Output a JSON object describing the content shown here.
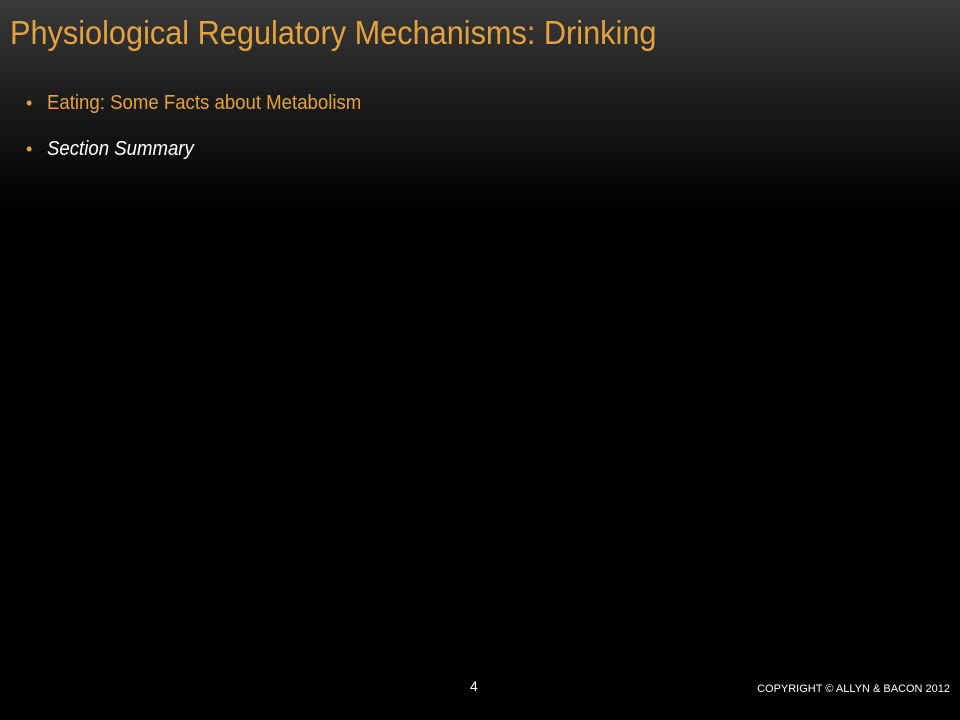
{
  "slide": {
    "title": "Physiological Regulatory Mechanisms: Drinking",
    "bullet_char": "•",
    "bullets": [
      {
        "label": "Eating: Some Facts about Metabolism"
      },
      {
        "label": "Section Summary"
      }
    ],
    "page_number": "4",
    "copyright": "COPYRIGHT © ALLYN & BACON 2012"
  },
  "colors": {
    "accent": "#e3a23c",
    "text": "#ffffff",
    "background": "#000000"
  }
}
